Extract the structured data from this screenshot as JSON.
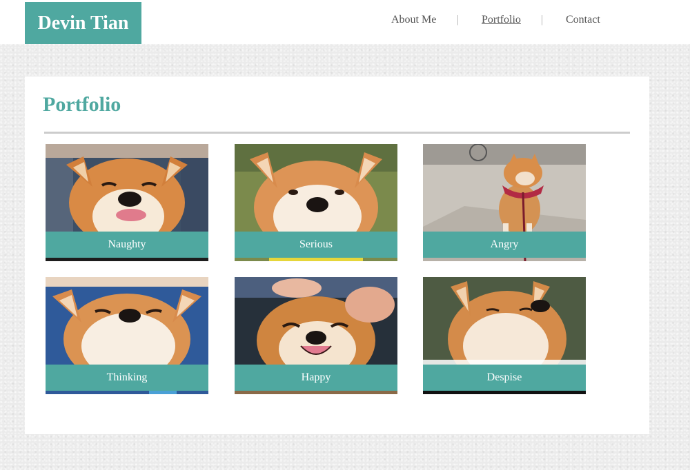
{
  "site": {
    "logo": "Devin Tian"
  },
  "nav": {
    "items": [
      {
        "label": "About Me"
      },
      {
        "label": "Portfolio"
      },
      {
        "label": "Contact"
      }
    ],
    "separator": "|"
  },
  "portfolio": {
    "title": "Portfolio",
    "cards": [
      {
        "caption": "Naughty"
      },
      {
        "caption": "Serious"
      },
      {
        "caption": "Angry"
      },
      {
        "caption": "Thinking"
      },
      {
        "caption": "Happy"
      },
      {
        "caption": "Despise"
      }
    ]
  },
  "colors": {
    "accent": "#4fa8a0",
    "text": "#555555",
    "background": "#ebebeb"
  }
}
